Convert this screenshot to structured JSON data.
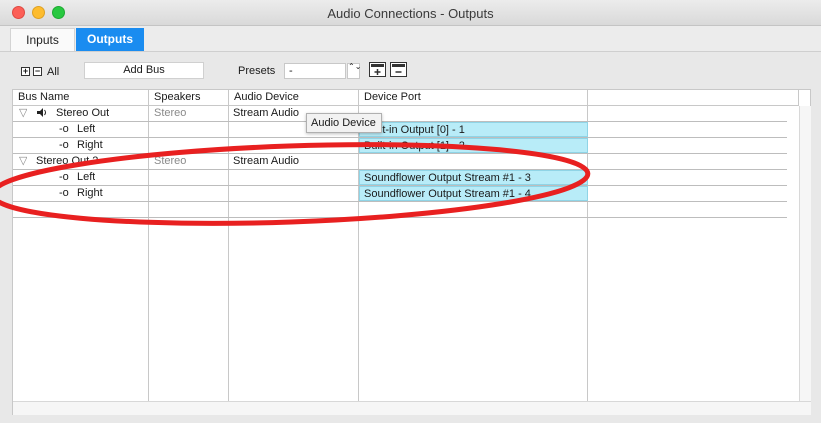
{
  "window": {
    "title": "Audio Connections - Outputs"
  },
  "tabs": [
    {
      "label": "Inputs"
    },
    {
      "label": "Outputs"
    }
  ],
  "toolbar": {
    "all_label": "All",
    "expand_glyph": "+",
    "collapse_glyph": "−",
    "add_bus_label": "Add Bus",
    "presets_label": "Presets",
    "presets_value": "-",
    "stepper_glyph": "⌃⌄"
  },
  "table": {
    "headers": [
      "Bus Name",
      "Speakers",
      "Audio Device",
      "Device Port"
    ],
    "rows": [
      {
        "name": "Stereo Out",
        "speakers": "Stereo",
        "device": "Stream Audio",
        "port": ""
      },
      {
        "name": "Left",
        "speakers": "",
        "device": "",
        "port": "Built-in Output [0] - 1"
      },
      {
        "name": "Right",
        "speakers": "",
        "device": "",
        "port": "Built-in Output [1] - 2"
      },
      {
        "name": "Stereo Out 2",
        "speakers": "Stereo",
        "device": "Stream Audio",
        "port": ""
      },
      {
        "name": "Left",
        "speakers": "",
        "device": "",
        "port": "Soundflower Output Stream #1 - 3"
      },
      {
        "name": "Right",
        "speakers": "",
        "device": "",
        "port": "Soundflower Output Stream #1 - 4"
      }
    ]
  },
  "tooltip": {
    "text": "Audio Device"
  },
  "icons": {
    "disclosure": "▽",
    "speaker": "🔈",
    "channel": "-o"
  },
  "colors": {
    "accent": "#1a8cf0",
    "port_highlight": "#b8ecf8",
    "annotation": "#e82020"
  }
}
